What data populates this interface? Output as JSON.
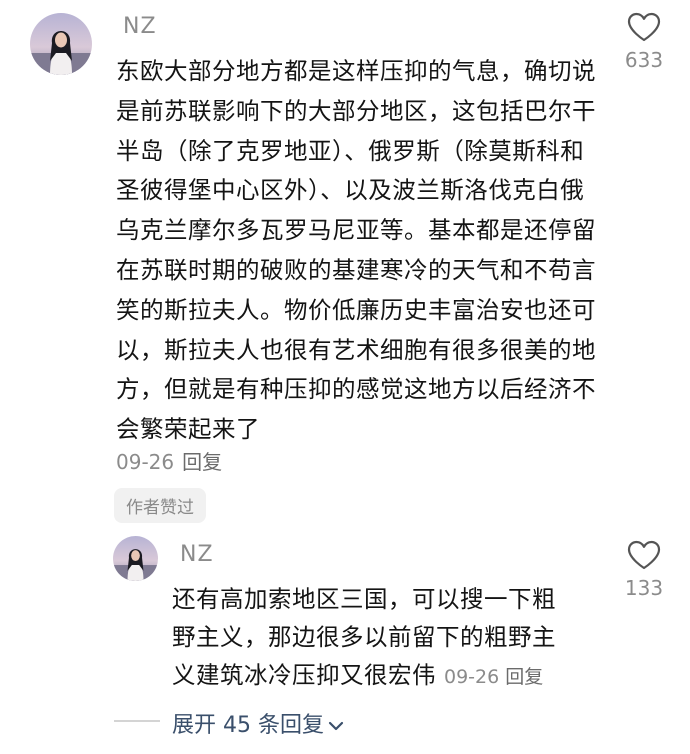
{
  "comment": {
    "username": "NZ",
    "text": "东欧大部分地方都是这样压抑的气息，确切说是前苏联影响下的大部分地区，这包括巴尔干半岛（除了克罗地亚）、俄罗斯（除莫斯科和圣彼得堡中心区外）、以及波兰斯洛伐克白俄乌克兰摩尔多瓦罗马尼亚等。基本都是还停留在苏联时期的破败的基建寒冷的天气和不苟言笑的斯拉夫人。物价低廉历史丰富治安也还可以，斯拉夫人也很有艺术细胞有很多很美的地方，但就是有种压抑的感觉这地方以后经济不会繁荣起来了",
    "date": "09-26",
    "reply_label": "回复",
    "like_count": "633",
    "author_liked_badge": "作者赞过"
  },
  "reply": {
    "username": "NZ",
    "text": "还有高加索地区三国，可以搜一下粗野主义，那边很多以前留下的粗野主义建筑冰冷压抑又很宏伟",
    "date": "09-26",
    "reply_label": "回复",
    "like_count": "133"
  },
  "expand": {
    "label": "展开 45 条回复"
  },
  "icons": {
    "like": "heart-outline-icon",
    "expand": "chevron-down-icon"
  },
  "colors": {
    "meta_gray": "#8b8b8b",
    "expand_blue": "#3a4f6b"
  }
}
